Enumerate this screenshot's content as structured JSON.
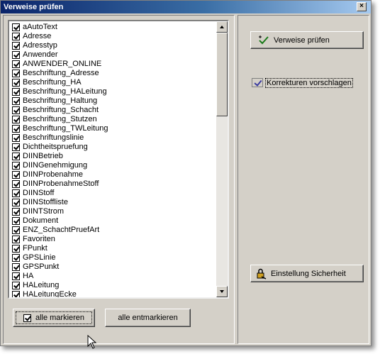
{
  "window": {
    "title": "Verweise prüfen",
    "close_glyph": "×"
  },
  "list": {
    "items": [
      "aAutoText",
      "Adresse",
      "Adresstyp",
      "Anwender",
      "ANWENDER_ONLINE",
      "Beschriftung_Adresse",
      "Beschriftung_HA",
      "Beschriftung_HALeitung",
      "Beschriftung_Haltung",
      "Beschriftung_Schacht",
      "Beschriftung_Stutzen",
      "Beschriftung_TWLeitung",
      "Beschriftungslinie",
      "Dichtheitspruefung",
      "DIINBetrieb",
      "DIINGenehmigung",
      "DIINProbenahme",
      "DIINProbenahmeStoff",
      "DIINStoff",
      "DIINStoffliste",
      "DIINTStrom",
      "Dokument",
      "ENZ_SchachtPruefArt",
      "Favoriten",
      "FPunkt",
      "GPSLinie",
      "GPSPunkt",
      "HA",
      "HALeitung",
      "HALeitungEcke"
    ],
    "all_checked": true
  },
  "buttons": {
    "mark_all": "alle markieren",
    "unmark_all": "alle entmarkieren",
    "check_refs": "Verweise prüfen",
    "security": "Einstellung Sicherheit"
  },
  "options": {
    "suggest_corrections_label": "Korrekturen vorschlagen",
    "suggest_corrections_checked": true
  },
  "icons": {
    "check_refs": "check-arrow-icon",
    "security": "lock-key-icon",
    "mark_all": "checkbox-icon"
  }
}
